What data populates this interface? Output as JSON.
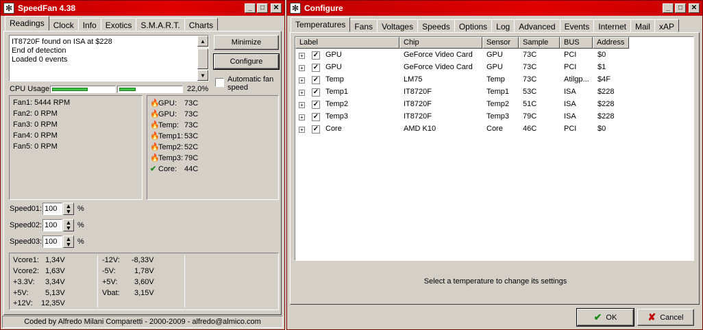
{
  "speedfan": {
    "title": "SpeedFan 4.38",
    "tabs": [
      "Readings",
      "Clock",
      "Info",
      "Exotics",
      "S.M.A.R.T.",
      "Charts"
    ],
    "log_lines": [
      "IT8720F found on ISA at $228",
      "End of detection",
      "Loaded 0 events"
    ],
    "minimize_label": "Minimize",
    "configure_label": "Configure",
    "auto_fan_label_1": "Automatic fan",
    "auto_fan_label_2": "speed",
    "cpu_usage_label": "CPU Usage",
    "cpu_usage_value": "22,0%",
    "cpu_bar_fraction": [
      0.58,
      0.27
    ],
    "fans": [
      "Fan1: 5444 RPM",
      "Fan2: 0 RPM",
      "Fan3: 0 RPM",
      "Fan4: 0 RPM",
      "Fan5: 0 RPM"
    ],
    "temps": [
      {
        "label": "GPU:",
        "value": "73C",
        "icon": "flame-icon"
      },
      {
        "label": "GPU:",
        "value": "73C",
        "icon": "flame-icon"
      },
      {
        "label": "Temp:",
        "value": "73C",
        "icon": "flame-icon"
      },
      {
        "label": "Temp1:",
        "value": "53C",
        "icon": "flame-icon"
      },
      {
        "label": "Temp2:",
        "value": "52C",
        "icon": "flame-icon"
      },
      {
        "label": "Temp3:",
        "value": "79C",
        "icon": "flame-icon"
      },
      {
        "label": "Core:",
        "value": "44C",
        "icon": "checkmark-icon"
      }
    ],
    "speeds": [
      {
        "label": "Speed01:",
        "value": "100"
      },
      {
        "label": "Speed02:",
        "value": "100"
      },
      {
        "label": "Speed03:",
        "value": "100"
      }
    ],
    "percent_sign": "%",
    "voltages_left": [
      {
        "label": "Vcore1:",
        "value": "1,34V"
      },
      {
        "label": "Vcore2:",
        "value": "1,63V"
      },
      {
        "label": "+3.3V:",
        "value": "3,34V"
      },
      {
        "label": "+5V:",
        "value": "5,13V"
      },
      {
        "label": "+12V:",
        "value": "12,35V"
      }
    ],
    "voltages_right": [
      {
        "label": "-12V:",
        "value": "-8,33V"
      },
      {
        "label": "-5V:",
        "value": "1,78V"
      },
      {
        "label": "+5V:",
        "value": "3,60V"
      },
      {
        "label": "Vbat:",
        "value": "3,15V"
      }
    ],
    "status_bar": "Coded by Alfredo Milani Comparetti - 2000-2009 - alfredo@almico.com"
  },
  "configure": {
    "title": "Configure",
    "tabs": [
      "Temperatures",
      "Fans",
      "Voltages",
      "Speeds",
      "Options",
      "Log",
      "Advanced",
      "Events",
      "Internet",
      "Mail",
      "xAP"
    ],
    "columns": [
      "Label",
      "Chip",
      "Sensor",
      "Sample",
      "BUS",
      "Address"
    ],
    "rows": [
      {
        "label": "GPU",
        "chip": "GeForce Video Card",
        "sensor": "GPU",
        "sample": "73C",
        "bus": "PCI",
        "address": "$0"
      },
      {
        "label": "GPU",
        "chip": "GeForce Video Card",
        "sensor": "GPU",
        "sample": "73C",
        "bus": "PCI",
        "address": "$1"
      },
      {
        "label": "Temp",
        "chip": "LM75",
        "sensor": "Temp",
        "sample": "73C",
        "bus": "Atilgp...",
        "address": "$4F"
      },
      {
        "label": "Temp1",
        "chip": "IT8720F",
        "sensor": "Temp1",
        "sample": "53C",
        "bus": "ISA",
        "address": "$228"
      },
      {
        "label": "Temp2",
        "chip": "IT8720F",
        "sensor": "Temp2",
        "sample": "51C",
        "bus": "ISA",
        "address": "$228"
      },
      {
        "label": "Temp3",
        "chip": "IT8720F",
        "sensor": "Temp3",
        "sample": "79C",
        "bus": "ISA",
        "address": "$228"
      },
      {
        "label": "Core",
        "chip": "AMD K10",
        "sensor": "Core",
        "sample": "46C",
        "bus": "PCI",
        "address": "$0"
      }
    ],
    "hint": "Select a temperature to change its settings",
    "ok_label": "OK",
    "cancel_label": "Cancel"
  }
}
